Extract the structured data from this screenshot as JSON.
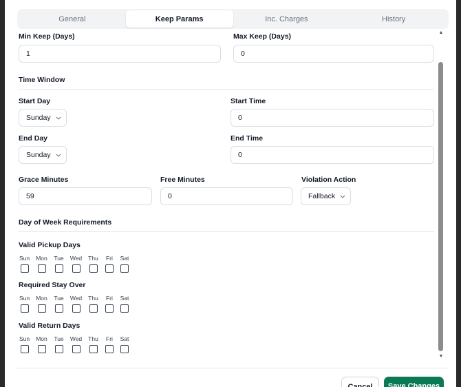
{
  "tabs": [
    {
      "label": "General",
      "active": false
    },
    {
      "label": "Keep Params",
      "active": true
    },
    {
      "label": "Inc. Charges",
      "active": false
    },
    {
      "label": "History",
      "active": false
    }
  ],
  "min_keep": {
    "label": "Min Keep (Days)",
    "value": "1"
  },
  "max_keep": {
    "label": "Max Keep (Days)",
    "value": "0"
  },
  "time_window": {
    "title": "Time Window"
  },
  "start_day": {
    "label": "Start Day",
    "value": "Sunday"
  },
  "start_time": {
    "label": "Start Time",
    "value": "0"
  },
  "end_day": {
    "label": "End Day",
    "value": "Sunday"
  },
  "end_time": {
    "label": "End Time",
    "value": "0"
  },
  "grace_minutes": {
    "label": "Grace Minutes",
    "value": "59"
  },
  "free_minutes": {
    "label": "Free Minutes",
    "value": "0"
  },
  "violation_action": {
    "label": "Violation Action",
    "value": "Fallback"
  },
  "dow": {
    "title": "Day of Week Requirements"
  },
  "day_labels": [
    "Sun",
    "Mon",
    "Tue",
    "Wed",
    "Thu",
    "Fri",
    "Sat"
  ],
  "pickup_days": {
    "label": "Valid Pickup Days"
  },
  "stay_over": {
    "label": "Required Stay Over"
  },
  "return_days": {
    "label": "Valid Return Days"
  },
  "footer": {
    "cancel_label": "Cancel",
    "save_label": "Save Changes"
  },
  "colors": {
    "primary": "#0a7a55",
    "border": "#d9dde3"
  }
}
